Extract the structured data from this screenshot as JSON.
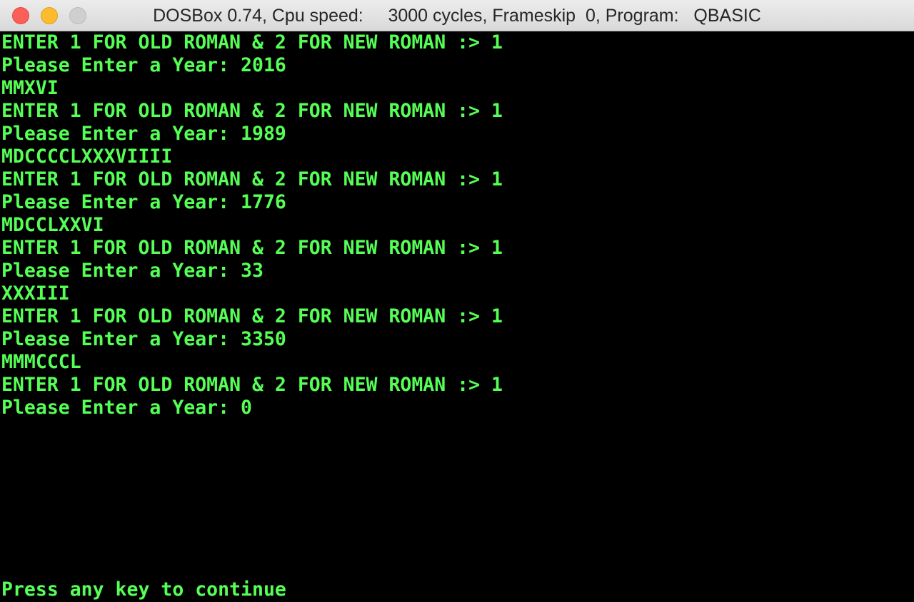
{
  "window": {
    "title": "DOSBox 0.74, Cpu speed:     3000 cycles, Frameskip  0, Program:   QBASIC"
  },
  "console": {
    "lines": [
      "ENTER 1 FOR OLD ROMAN & 2 FOR NEW ROMAN :> 1",
      "Please Enter a Year: 2016",
      "MMXVI",
      "ENTER 1 FOR OLD ROMAN & 2 FOR NEW ROMAN :> 1",
      "Please Enter a Year: 1989",
      "MDCCCCLXXXVIIII",
      "ENTER 1 FOR OLD ROMAN & 2 FOR NEW ROMAN :> 1",
      "Please Enter a Year: 1776",
      "MDCCLXXVI",
      "ENTER 1 FOR OLD ROMAN & 2 FOR NEW ROMAN :> 1",
      "Please Enter a Year: 33",
      "XXXIII",
      "ENTER 1 FOR OLD ROMAN & 2 FOR NEW ROMAN :> 1",
      "Please Enter a Year: 3350",
      "MMMCCCL",
      "ENTER 1 FOR OLD ROMAN & 2 FOR NEW ROMAN :> 1",
      "Please Enter a Year: 0"
    ],
    "prompt": "Press any key to continue"
  },
  "colors": {
    "text": "#55ff55",
    "background": "#000000"
  }
}
